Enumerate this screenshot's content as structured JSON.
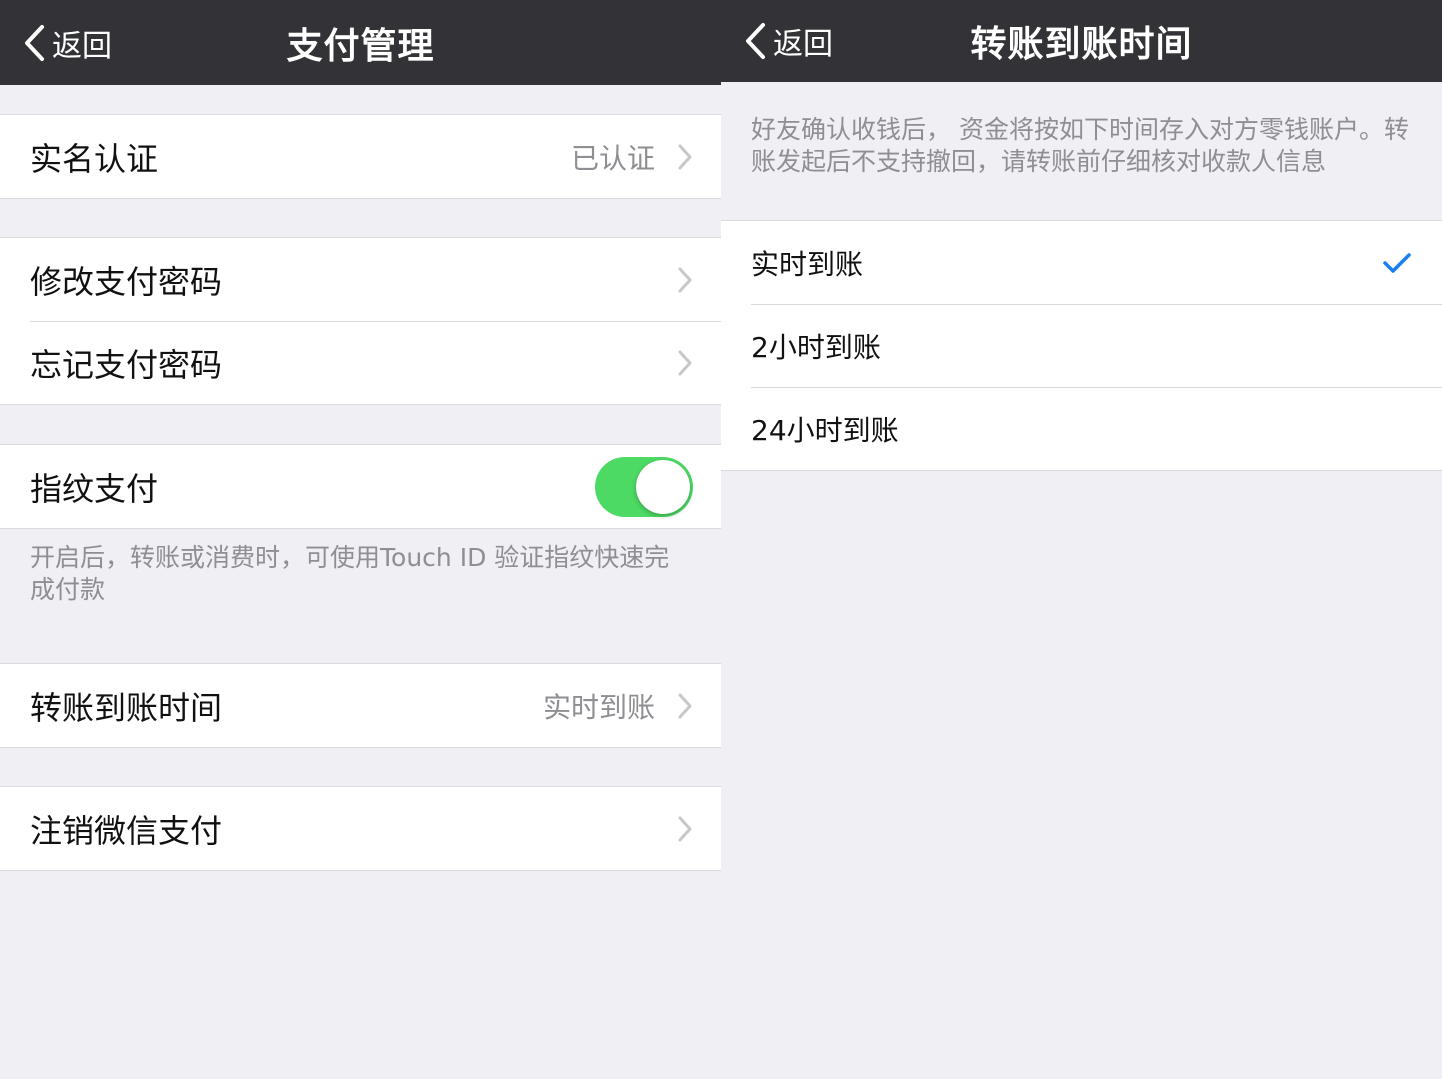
{
  "left_screen": {
    "back_label": "返回",
    "title": "支付管理",
    "real_name": {
      "label": "实名认证",
      "value": "已认证"
    },
    "change_password": {
      "label": "修改支付密码"
    },
    "forgot_password": {
      "label": "忘记支付密码"
    },
    "fingerprint": {
      "label": "指纹支付",
      "enabled": true
    },
    "fingerprint_note": "开启后，转账或消费时，可使用Touch ID 验证指纹快速完成付款",
    "transfer_time": {
      "label": "转账到账时间",
      "value": "实时到账"
    },
    "cancel_wechat_pay": {
      "label": "注销微信支付"
    }
  },
  "right_screen": {
    "back_label": "返回",
    "title": "转账到账时间",
    "note": "好友确认收钱后， 资金将按如下时间存入对方零钱账户。转账发起后不支持撤回，请转账前仔细核对收款人信息",
    "options": [
      {
        "label": "实时到账",
        "selected": true
      },
      {
        "label": "2小时到账",
        "selected": false
      },
      {
        "label": "24小时到账",
        "selected": false
      }
    ]
  },
  "colors": {
    "navbar": "#333337",
    "background": "#efeff4",
    "toggle_on": "#4cd964",
    "checkmark": "#1a7ef2",
    "secondary_text": "#8e8e93"
  }
}
